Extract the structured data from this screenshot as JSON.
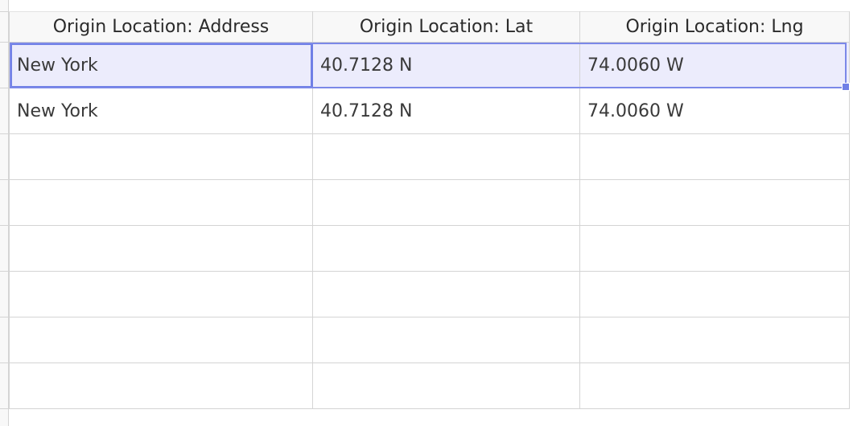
{
  "columns": [
    {
      "header": "Origin Location: Address"
    },
    {
      "header": "Origin Location: Lat"
    },
    {
      "header": "Origin Location: Lng"
    }
  ],
  "rows": [
    {
      "address": "New York",
      "lat": "40.7128 N",
      "lng": "74.0060 W",
      "selected": true
    },
    {
      "address": "New York",
      "lat": "40.7128 N",
      "lng": "74.0060 W",
      "selected": false
    },
    {
      "address": "",
      "lat": "",
      "lng": ""
    },
    {
      "address": "",
      "lat": "",
      "lng": ""
    },
    {
      "address": "",
      "lat": "",
      "lng": ""
    },
    {
      "address": "",
      "lat": "",
      "lng": ""
    },
    {
      "address": "",
      "lat": "",
      "lng": ""
    },
    {
      "address": "",
      "lat": "",
      "lng": ""
    }
  ],
  "colors": {
    "selection": "#6f7fe6",
    "selected_row_fill": "#ececfc",
    "grid_line": "#d4d4d4",
    "header_fill": "#f8f8f8"
  }
}
